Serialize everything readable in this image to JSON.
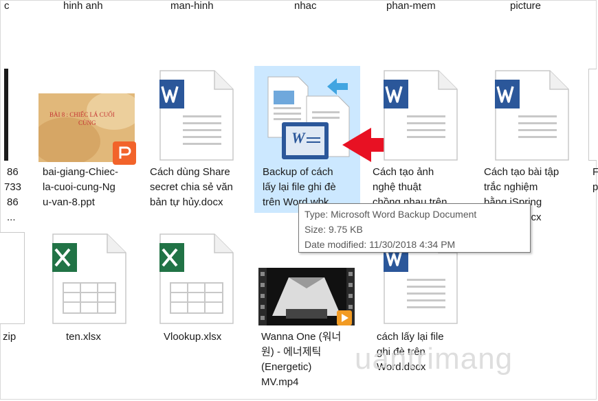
{
  "top_folders": [
    "c",
    "hinh anh",
    "man-hinh",
    "nhac",
    "phan-mem",
    "picture"
  ],
  "left_partial": {
    "row1": [
      "86",
      "733",
      "86",
      "..."
    ],
    "row2": "zip"
  },
  "row1": [
    {
      "name": "bai-giang-Chiec-la-cuoi-cung-Ngu-van-8.ppt",
      "lines": [
        "bai-giang-Chiec-",
        "la-cuoi-cung-Ng",
        "u-van-8.ppt"
      ],
      "thumb_text": "BÀI 8 : CHIẾC LÁ CUỐI CÙNG"
    },
    {
      "name": "Cách dùng Share secret chia sẻ văn bản tự hủy.docx",
      "lines": [
        "Cách dùng Share",
        "secret chia sẻ văn",
        "bản tự hủy.docx"
      ]
    },
    {
      "name": "Backup of cách lấy lại file ghi đè trên Word.wbk",
      "lines": [
        "Backup of cách",
        "lấy lại file ghi đè",
        "trên Word.wbk"
      ]
    },
    {
      "name": "Cách tạo ảnh nghệ thuật chồng nhau trên",
      "lines": [
        "Cách tạo ảnh",
        "nghệ thuật",
        "chồng nhau trên"
      ]
    },
    {
      "name": "Cách tạo bài tập trắc nghiệm bằng iSpring",
      "lines": [
        "Cách tạo bài tập",
        "trắc nghiệm",
        "bằng iSpring",
        "...cx"
      ]
    }
  ],
  "right_partial": [
    "F",
    "p"
  ],
  "row2": [
    {
      "name": "ten.xlsx",
      "lines": [
        "ten.xlsx"
      ]
    },
    {
      "name": "Vlookup.xlsx",
      "lines": [
        "Vlookup.xlsx"
      ]
    },
    {
      "name": "Wanna One (워너원) - 에너제틱 (Energetic) MV.mp4",
      "lines": [
        "Wanna One (워너",
        "원) - 에너제틱",
        "(Energetic)",
        "MV.mp4"
      ]
    },
    {
      "name": "cách lấy lại file ghi đè trên Word.docx",
      "lines": [
        "cách lấy lại file",
        "ghi đè trên",
        "Word.docx"
      ]
    }
  ],
  "tooltip": {
    "type": "Type: Microsoft Word Backup Document",
    "size": "Size: 9.75 KB",
    "date": "Date modified: 11/30/2018 4:34 PM"
  },
  "watermark": "uantrimang",
  "colors": {
    "word_blue": "#2b579a",
    "excel_green": "#217346",
    "selection": "#cce8ff",
    "arrow_red": "#e81123",
    "ppt_orange": "#f2632a"
  }
}
